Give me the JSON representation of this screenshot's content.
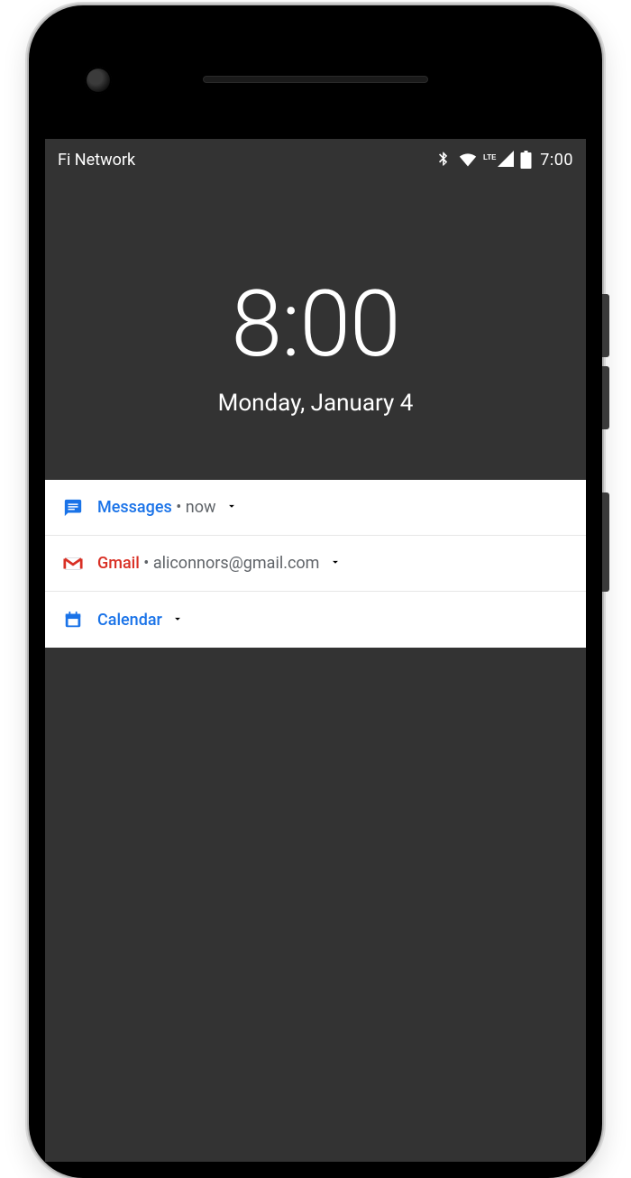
{
  "statusbar": {
    "carrier": "Fi Network",
    "time": "7:00"
  },
  "clock": {
    "time": "8:00",
    "date": "Monday, January 4"
  },
  "notifications": [
    {
      "app": "Messages",
      "subtitle": "now",
      "accent": "#1a73e8"
    },
    {
      "app": "Gmail",
      "subtitle": "aliconnors@gmail.com",
      "accent": "#d93025"
    },
    {
      "app": "Calendar",
      "subtitle": "",
      "accent": "#1a73e8"
    }
  ]
}
